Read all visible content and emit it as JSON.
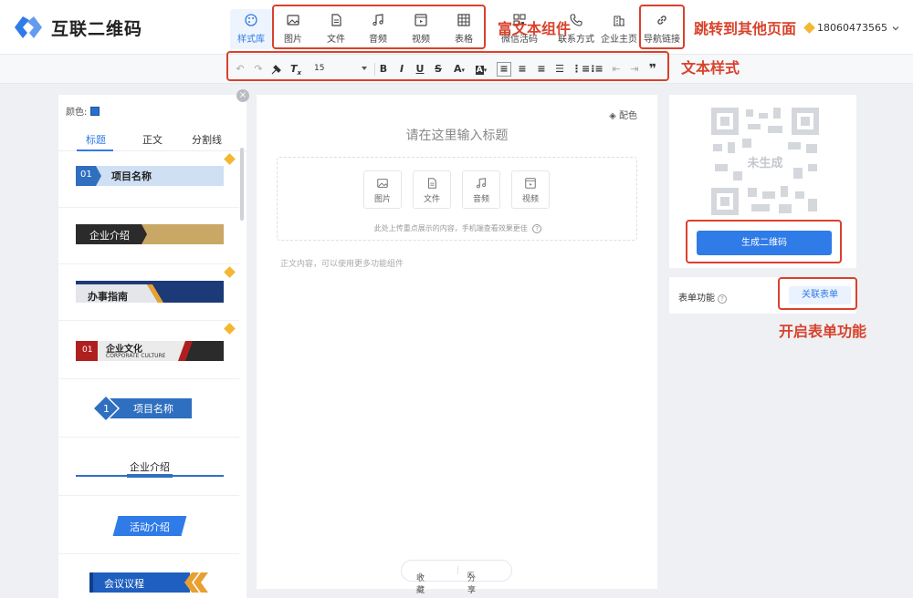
{
  "app": {
    "title": "互联二维码"
  },
  "header": {
    "style_lib": "样式库",
    "rich_tools": [
      "图片",
      "文件",
      "音频",
      "视频",
      "表格"
    ],
    "more_tools": [
      "微信活码",
      "联系方式",
      "企业主页",
      "导航链接"
    ],
    "user_phone": "18060473565"
  },
  "format": {
    "font_size": "15"
  },
  "annotations": {
    "rich_text": "富文本组件",
    "jump": "跳转到其他页面",
    "text_style": "文本样式",
    "form_enable": "开启表单功能"
  },
  "leftpanel": {
    "color_label": "颜色:",
    "tabs": [
      "标题",
      "正文",
      "分割线"
    ],
    "templates": [
      "项目名称",
      "企业介绍",
      "办事指南",
      "企业文化",
      "项目名称",
      "企业介绍",
      "活动介绍",
      "会议议程"
    ],
    "tpl4_num": "01",
    "tpl4_sub": "CORPORATE CULTURE",
    "tpl1_num": "01",
    "tpl5_num": "1"
  },
  "editor": {
    "peise": "配色",
    "title_placeholder": "请在这里输入标题",
    "upload_items": [
      "图片",
      "文件",
      "音频",
      "视频"
    ],
    "upload_hint": "此处上传重点展示的内容，手机端查看效果更佳",
    "body_placeholder": "正文内容，可以使用更多功能组件",
    "favorite": "收藏",
    "share": "分享"
  },
  "right": {
    "qr_status": "未生成",
    "generate": "生成二维码",
    "form_label": "表单功能",
    "link_form": "关联表单"
  },
  "colors": {
    "accent": "#2f7be8",
    "annotation": "#d9422c"
  }
}
